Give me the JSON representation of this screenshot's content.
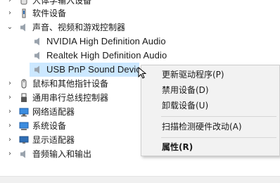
{
  "tree": {
    "items": [
      {
        "label": "人体学输入设备",
        "icon": "hid-device-icon",
        "expanded": false
      },
      {
        "label": "软件设备",
        "icon": "software-device-icon",
        "expanded": false
      },
      {
        "label": "声音、视频和游戏控制器",
        "icon": "speaker-icon",
        "expanded": true
      },
      {
        "label": "NVIDIA High Definition Audio",
        "icon": "speaker-icon"
      },
      {
        "label": "Realtek High Definition Audio",
        "icon": "speaker-icon"
      },
      {
        "label": "USB PnP Sound Device",
        "icon": "speaker-icon",
        "selected": true
      },
      {
        "label": "鼠标和其他指针设备",
        "icon": "mouse-icon",
        "expanded": false
      },
      {
        "label": "通用串行总线控制器",
        "icon": "usb-icon",
        "expanded": false
      },
      {
        "label": "网络适配器",
        "icon": "network-adapter-icon",
        "expanded": false
      },
      {
        "label": "系统设备",
        "icon": "system-device-icon",
        "expanded": false
      },
      {
        "label": "显示适配器",
        "icon": "display-adapter-icon",
        "expanded": false
      },
      {
        "label": "音频输入和输出",
        "icon": "speaker-icon",
        "expanded": false
      }
    ]
  },
  "context_menu": {
    "update_driver": "更新驱动程序(P)",
    "disable_device": "禁用设备(D)",
    "uninstall_device": "卸载设备(U)",
    "scan_hardware": "扫描检测硬件改动(A)",
    "properties": "属性(R)"
  },
  "colors": {
    "selection": "#cce8ff",
    "menu_background": "#f2f2f2",
    "icon_blue": "#2f6fb6"
  }
}
